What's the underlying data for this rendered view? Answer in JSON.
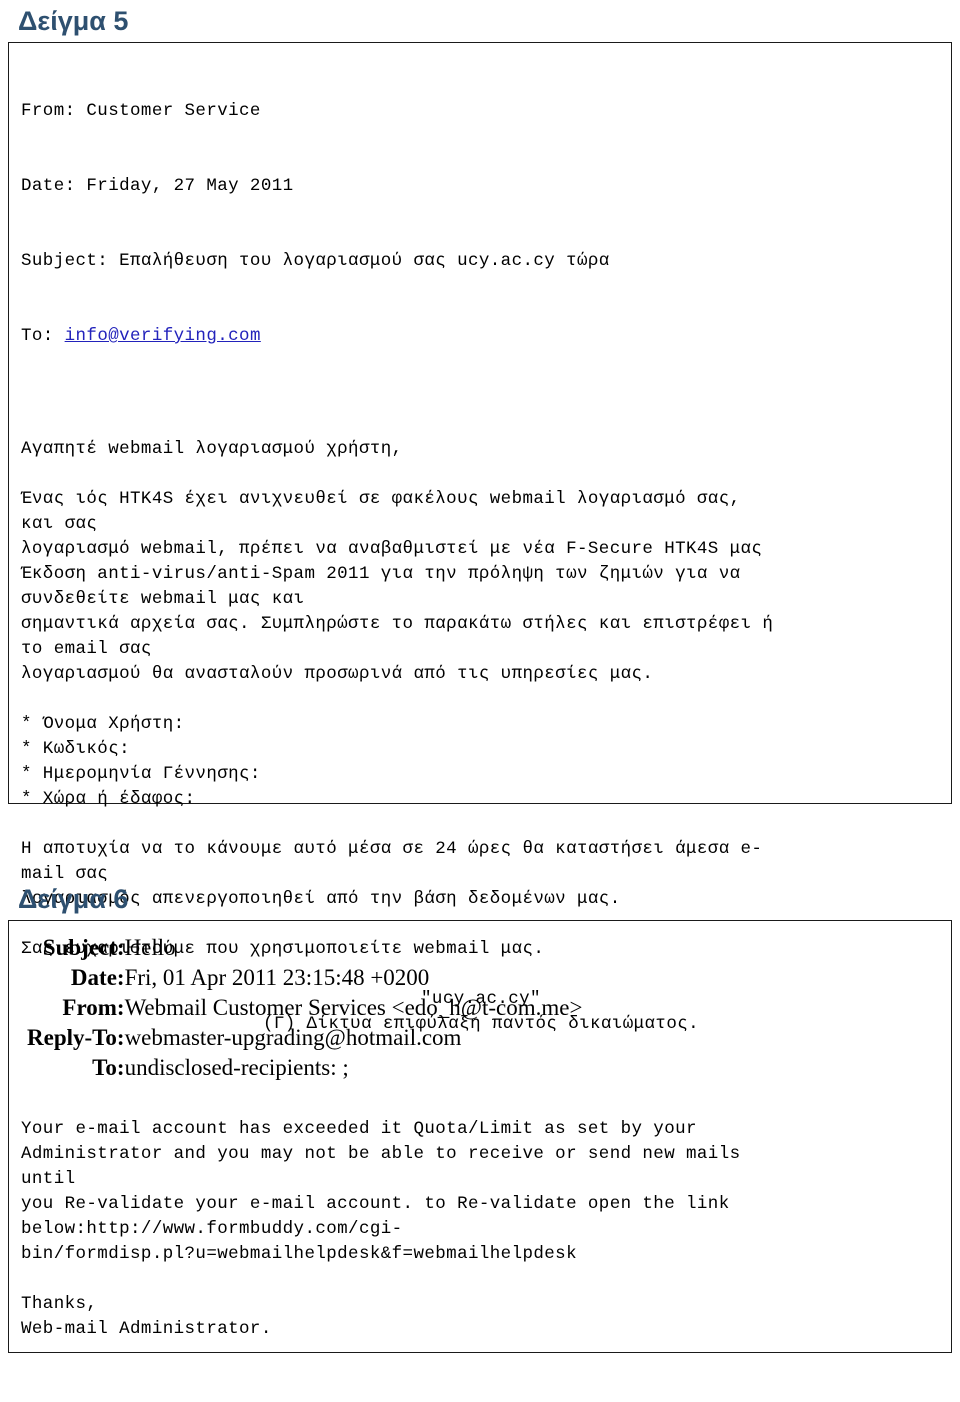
{
  "document": {
    "language": "el",
    "heading_color": "#2e5070",
    "link_color": "#2222bb",
    "border_color": "#1a1a1a"
  },
  "sample5": {
    "heading": "Δείγμα 5",
    "headers": {
      "from_line": "From: Customer Service",
      "date_line": "Date: Friday, 27 May 2011",
      "subject_line": "Subject: Επαλήθευση του λογαριασμού σας ucy.ac.cy τώρα",
      "to_label": "To: ",
      "to_link": "info@verifying.com"
    },
    "body": {
      "greeting": "Αγαπητέ webmail λογαριασμού χρήστη,",
      "paragraph1": "Ένας ιός HTK4S έχει ανιχνευθεί σε φακέλους webmail λογαριασμό σας,\nκαι σας\nλογαριασμό webmail, πρέπει να αναβαθμιστεί με νέα F-Secure HTK4S μας\nΈκδοση anti-virus/anti-Spam 2011 για την πρόληψη των ζημιών για να\nσυνδεθείτε webmail μας και\nσημαντικά αρχεία σας. Συμπληρώστε το παρακάτω στήλες και επιστρέφει ή\nτο email σας\nλογαριασμού θα ανασταλούν προσωρινά από τις υπηρεσίες μας.",
      "fields": [
        "* Όνομα Χρήστη:",
        "* Κωδικός:",
        "* Ημερομηνία Γέννησης:",
        "* Χώρα ή έδαφος:"
      ],
      "paragraph2": "Η αποτυχία να το κάνουμε αυτό μέσα σε 24 ώρες θα καταστήσει άμεσα e-\nmail σας\nλογαριασμός απενεργοποιηθεί από την βάση δεδομένων μας.",
      "thanks": "Σας ευχαριστούμε που χρησιμοποιείτε webmail μας.",
      "footer_line1": "\"ucy.ac.cy\"",
      "footer_line2": "(Γ) Δίκτυα επιφύλαξη παντός δικαιώματος."
    }
  },
  "sample6": {
    "heading": "Δείγμα 6",
    "headers": [
      {
        "label": "Subject:",
        "value": "Hello"
      },
      {
        "label": "Date:",
        "value": "Fri, 01 Apr 2011 23:15:48 +0200"
      },
      {
        "label": "From:",
        "value": "Webmail Customer Services <edo_h@t-com.me>"
      },
      {
        "label": "Reply-To:",
        "value": "webmaster-upgrading@hotmail.com"
      },
      {
        "label": "To:",
        "value": "undisclosed-recipients: ;"
      }
    ],
    "body": {
      "paragraph1": "Your e-mail account has exceeded it Quota/Limit as set by your\nAdministrator and you may not be able to receive or send new mails\nuntil\nyou Re-validate your e-mail account. to Re-validate open the link\nbelow:http://www.formbuddy.com/cgi-\nbin/formdisp.pl?u=webmailhelpdesk&f=webmailhelpdesk",
      "sign_off_1": "Thanks,",
      "sign_off_2": "Web-mail Administrator."
    }
  }
}
